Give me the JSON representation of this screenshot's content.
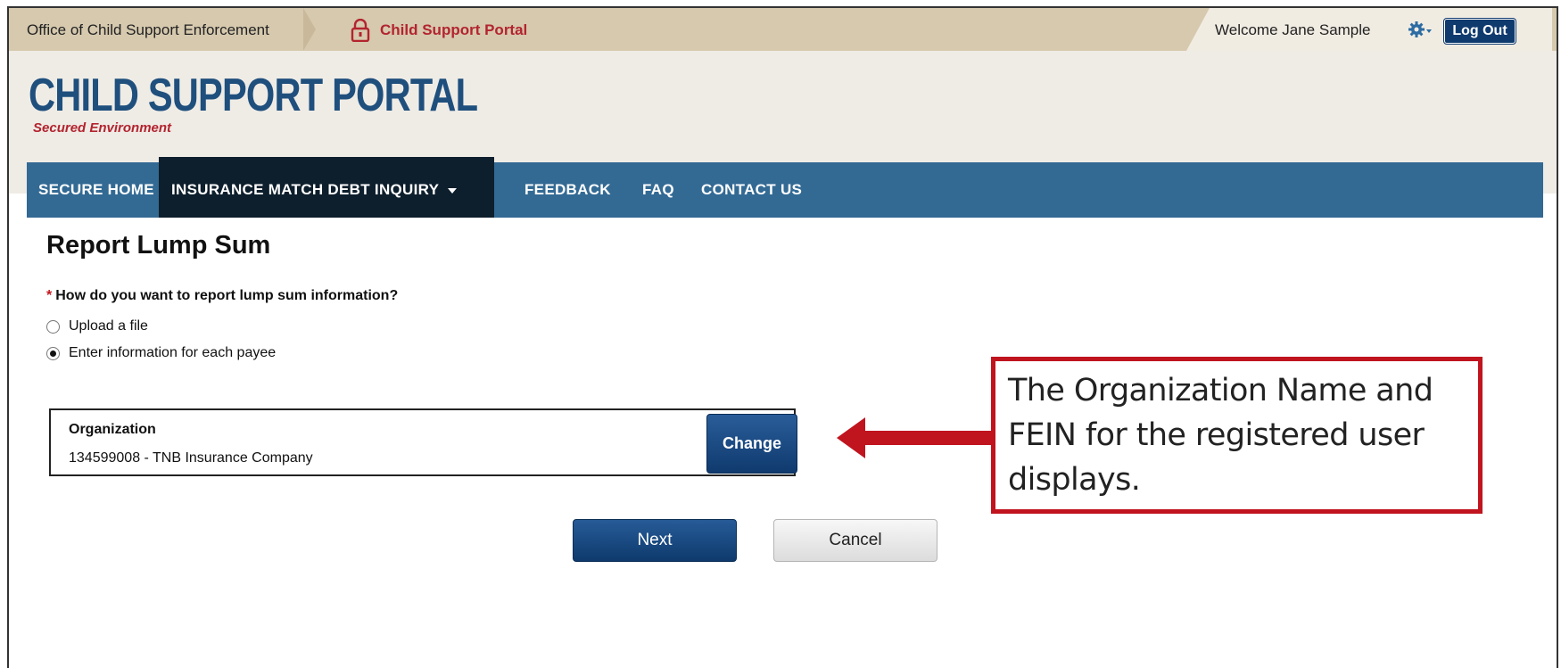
{
  "topbar": {
    "office": "Office of Child Support Enforcement",
    "portal": "Child Support Portal",
    "welcome": "Welcome Jane Sample",
    "logout": "Log Out"
  },
  "header": {
    "title": "CHILD SUPPORT PORTAL",
    "subtitle": "Secured Environment"
  },
  "nav": {
    "items": [
      {
        "label": "SECURE HOME"
      },
      {
        "label": "INSURANCE MATCH DEBT INQUIRY"
      },
      {
        "label": "FEEDBACK"
      },
      {
        "label": "FAQ"
      },
      {
        "label": "CONTACT US"
      }
    ]
  },
  "main": {
    "title": "Report Lump Sum",
    "required_mark": "*",
    "question": "How do you want to report lump sum information?",
    "options": [
      {
        "label": "Upload a file",
        "selected": false
      },
      {
        "label": "Enter information for each payee",
        "selected": true
      }
    ],
    "organization": {
      "label": "Organization",
      "value": "134599008 - TNB Insurance Company",
      "change_label": "Change"
    },
    "next_label": "Next",
    "cancel_label": "Cancel"
  },
  "callout": {
    "text": "The Organization Name and FEIN for the registered user displays."
  },
  "colors": {
    "brand_blue": "#1f4f7d",
    "nav_blue": "#336a94",
    "accent_red": "#b3242f",
    "callout_red": "#c0141f"
  }
}
